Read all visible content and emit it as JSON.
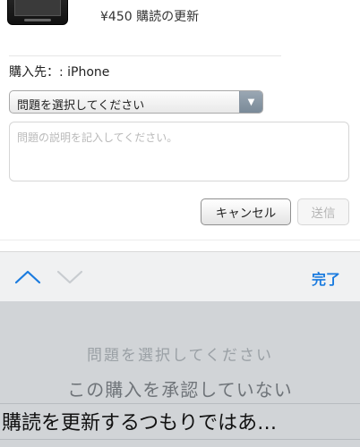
{
  "product": {
    "price_text": "¥450 購読の更新"
  },
  "form": {
    "purchase_from": "購入先：: iPhone",
    "select_value": "問題を選択してください",
    "textarea_placeholder": "問題の説明を記入してください。",
    "cancel_label": "キャンセル",
    "send_label": "送信"
  },
  "toolbar": {
    "done_label": "完了",
    "accent": "#1a7bdf",
    "icons": [
      "chevron-up-icon",
      "chevron-down-icon"
    ]
  },
  "picker": {
    "options": [
      "問題を選択してください",
      "この購入を承認していない",
      "購読を更新するつもりではあ…"
    ],
    "selected_index": 2
  }
}
